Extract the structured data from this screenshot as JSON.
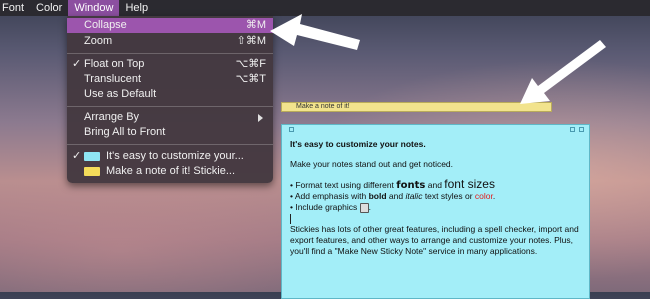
{
  "menubar": {
    "items": [
      "Font",
      "Color",
      "Window",
      "Help"
    ],
    "active": "Window"
  },
  "window_menu": {
    "collapse": {
      "label": "Collapse",
      "shortcut": "⌘M"
    },
    "zoom": {
      "label": "Zoom",
      "shortcut": "⇧⌘M"
    },
    "float_on_top": {
      "label": "Float on Top",
      "shortcut": "⌥⌘F",
      "checked": true
    },
    "translucent": {
      "label": "Translucent",
      "shortcut": "⌥⌘T"
    },
    "use_as_default": {
      "label": "Use as Default"
    },
    "arrange_by": {
      "label": "Arrange By"
    },
    "bring_all_to_front": {
      "label": "Bring All to Front"
    },
    "note_windows": [
      {
        "label": "It's easy to customize your...",
        "color": "#8fe6f4",
        "checked": true
      },
      {
        "label": "Make a note of it!  Stickie...",
        "color": "#f3dc5a",
        "checked": false
      }
    ]
  },
  "notes": {
    "yellow": {
      "title": "Make a note of it!",
      "color": "#f2e38d"
    },
    "blue": {
      "color": "#a3eef8",
      "heading": "It's easy to customize your notes.",
      "line1": "Make your notes stand out and get noticed.",
      "bullet1_prefix": "• Format text using different ",
      "bullet1_fonts": "fonts",
      "bullet1_and": " and ",
      "bullet1_sizes": "font sizes",
      "bullet2_prefix": "• Add emphasis with ",
      "bullet2_bold": "bold",
      "bullet2_and": " and ",
      "bullet2_italic": "italic",
      "bullet2_mid": " text styles or ",
      "bullet2_color": "color",
      "bullet2_end": ".",
      "bullet3_prefix": "• Include graphics ",
      "bullet3_end": ".",
      "para": "Stickies has lots of other great features, including a spell checker, import and export features, and other ways to arrange and customize your notes. Plus, you'll find a \"Make New Sticky Note\" service in many applications."
    }
  }
}
